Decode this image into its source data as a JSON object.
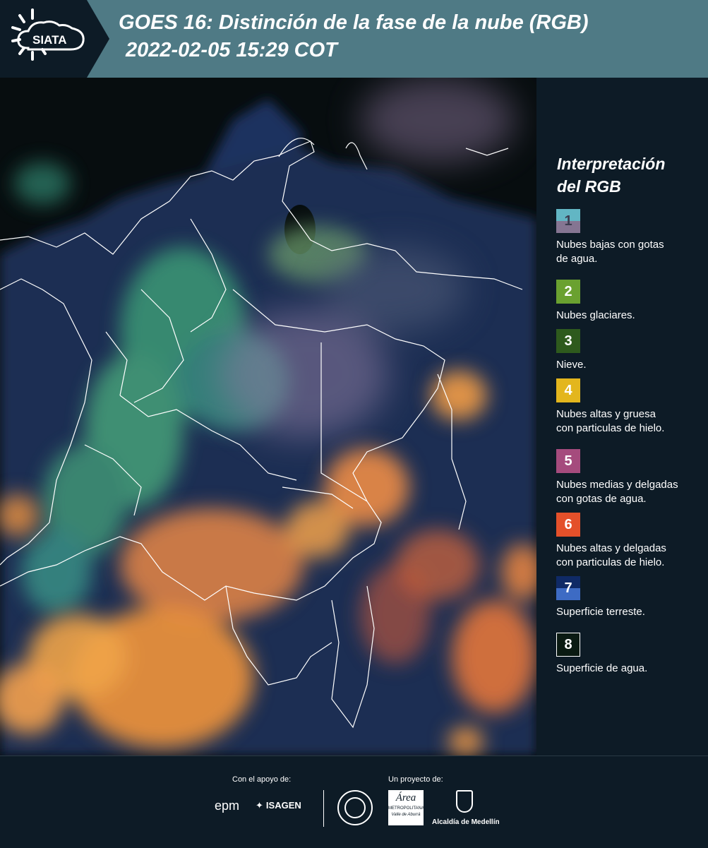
{
  "header": {
    "logo_text": "SIATA",
    "title_line1": "GOES 16: Distinción de la fase de la nube (RGB)",
    "title_line2": "2022-02-05 15:29 COT"
  },
  "legend": {
    "title_line1": "Interpretación",
    "title_line2": "del RGB",
    "items": [
      {
        "number": "1",
        "label_lines": [
          "Nubes bajas con gotas",
          "de agua."
        ],
        "color_top": "#62b6c4",
        "color_bottom": "#857592"
      },
      {
        "number": "2",
        "label_lines": [
          "Nubes glaciares."
        ],
        "color_top": "#6aa130",
        "color_bottom": "#6aa130"
      },
      {
        "number": "3",
        "label_lines": [
          "Nieve."
        ],
        "color_top": "#2e5a1d",
        "color_bottom": "#2e5a1d"
      },
      {
        "number": "4",
        "label_lines": [
          "Nubes altas y gruesa",
          "con particulas de hielo."
        ],
        "color_top": "#e3b61d",
        "color_bottom": "#e3b61d"
      },
      {
        "number": "5",
        "label_lines": [
          "Nubes medias y delgadas",
          "con gotas de agua."
        ],
        "color_top": "#a54b7d",
        "color_bottom": "#a54b7d"
      },
      {
        "number": "6",
        "label_lines": [
          "Nubes altas y delgadas",
          "con particulas de hielo."
        ],
        "color_top": "#e4502a",
        "color_bottom": "#e4502a"
      },
      {
        "number": "7",
        "label_lines": [
          "Superficie terreste."
        ],
        "color_top": "#0f2a66",
        "color_bottom": "#3d6bc4"
      },
      {
        "number": "8",
        "label_lines": [
          "Superficie de agua."
        ],
        "color_top": "#0a1a12",
        "color_bottom": "#0a1a12"
      }
    ]
  },
  "footer": {
    "support_label": "Con el apoyo de:",
    "project_label": "Un proyecto de:",
    "sponsor1": "epm",
    "sponsor2": "ISAGEN",
    "partner1_line1": "Área",
    "partner1_line2": "METROPOLITANA",
    "partner1_line3": "Valle de Aburrá",
    "partner2": "Alcaldía de Medellín"
  },
  "colors": {
    "header_bg": "#4f7a85",
    "header_logo_bg": "#0d1b26",
    "page_bg": "#0d1b26",
    "map_ocean": "#070d0f",
    "map_land": "#1b2d52",
    "cloud_orange": "#f08a3c",
    "cloud_green": "#4fc07a",
    "border_line": "#ffffff"
  }
}
